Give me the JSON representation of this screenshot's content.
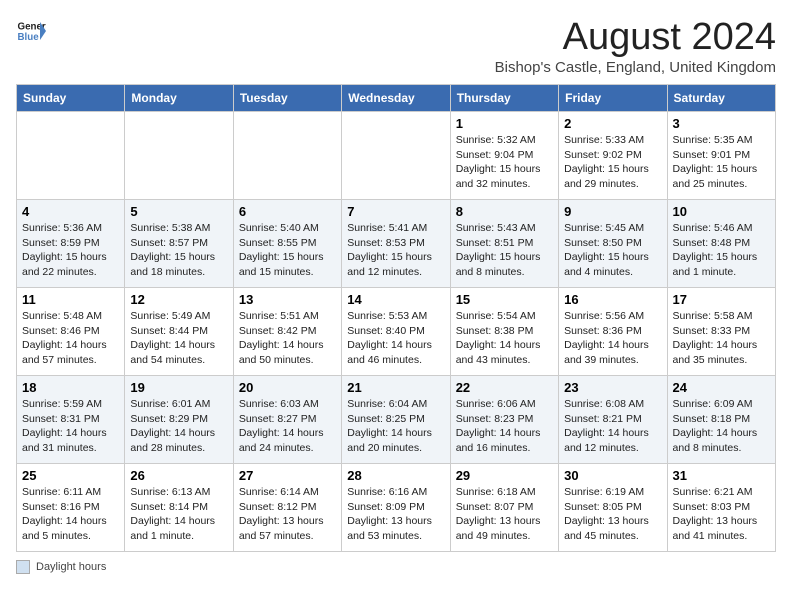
{
  "header": {
    "logo_line1": "General",
    "logo_line2": "Blue",
    "month": "August 2024",
    "location": "Bishop's Castle, England, United Kingdom"
  },
  "days_of_week": [
    "Sunday",
    "Monday",
    "Tuesday",
    "Wednesday",
    "Thursday",
    "Friday",
    "Saturday"
  ],
  "weeks": [
    [
      {
        "day": "",
        "info": ""
      },
      {
        "day": "",
        "info": ""
      },
      {
        "day": "",
        "info": ""
      },
      {
        "day": "",
        "info": ""
      },
      {
        "day": "1",
        "info": "Sunrise: 5:32 AM\nSunset: 9:04 PM\nDaylight: 15 hours\nand 32 minutes."
      },
      {
        "day": "2",
        "info": "Sunrise: 5:33 AM\nSunset: 9:02 PM\nDaylight: 15 hours\nand 29 minutes."
      },
      {
        "day": "3",
        "info": "Sunrise: 5:35 AM\nSunset: 9:01 PM\nDaylight: 15 hours\nand 25 minutes."
      }
    ],
    [
      {
        "day": "4",
        "info": "Sunrise: 5:36 AM\nSunset: 8:59 PM\nDaylight: 15 hours\nand 22 minutes."
      },
      {
        "day": "5",
        "info": "Sunrise: 5:38 AM\nSunset: 8:57 PM\nDaylight: 15 hours\nand 18 minutes."
      },
      {
        "day": "6",
        "info": "Sunrise: 5:40 AM\nSunset: 8:55 PM\nDaylight: 15 hours\nand 15 minutes."
      },
      {
        "day": "7",
        "info": "Sunrise: 5:41 AM\nSunset: 8:53 PM\nDaylight: 15 hours\nand 12 minutes."
      },
      {
        "day": "8",
        "info": "Sunrise: 5:43 AM\nSunset: 8:51 PM\nDaylight: 15 hours\nand 8 minutes."
      },
      {
        "day": "9",
        "info": "Sunrise: 5:45 AM\nSunset: 8:50 PM\nDaylight: 15 hours\nand 4 minutes."
      },
      {
        "day": "10",
        "info": "Sunrise: 5:46 AM\nSunset: 8:48 PM\nDaylight: 15 hours\nand 1 minute."
      }
    ],
    [
      {
        "day": "11",
        "info": "Sunrise: 5:48 AM\nSunset: 8:46 PM\nDaylight: 14 hours\nand 57 minutes."
      },
      {
        "day": "12",
        "info": "Sunrise: 5:49 AM\nSunset: 8:44 PM\nDaylight: 14 hours\nand 54 minutes."
      },
      {
        "day": "13",
        "info": "Sunrise: 5:51 AM\nSunset: 8:42 PM\nDaylight: 14 hours\nand 50 minutes."
      },
      {
        "day": "14",
        "info": "Sunrise: 5:53 AM\nSunset: 8:40 PM\nDaylight: 14 hours\nand 46 minutes."
      },
      {
        "day": "15",
        "info": "Sunrise: 5:54 AM\nSunset: 8:38 PM\nDaylight: 14 hours\nand 43 minutes."
      },
      {
        "day": "16",
        "info": "Sunrise: 5:56 AM\nSunset: 8:36 PM\nDaylight: 14 hours\nand 39 minutes."
      },
      {
        "day": "17",
        "info": "Sunrise: 5:58 AM\nSunset: 8:33 PM\nDaylight: 14 hours\nand 35 minutes."
      }
    ],
    [
      {
        "day": "18",
        "info": "Sunrise: 5:59 AM\nSunset: 8:31 PM\nDaylight: 14 hours\nand 31 minutes."
      },
      {
        "day": "19",
        "info": "Sunrise: 6:01 AM\nSunset: 8:29 PM\nDaylight: 14 hours\nand 28 minutes."
      },
      {
        "day": "20",
        "info": "Sunrise: 6:03 AM\nSunset: 8:27 PM\nDaylight: 14 hours\nand 24 minutes."
      },
      {
        "day": "21",
        "info": "Sunrise: 6:04 AM\nSunset: 8:25 PM\nDaylight: 14 hours\nand 20 minutes."
      },
      {
        "day": "22",
        "info": "Sunrise: 6:06 AM\nSunset: 8:23 PM\nDaylight: 14 hours\nand 16 minutes."
      },
      {
        "day": "23",
        "info": "Sunrise: 6:08 AM\nSunset: 8:21 PM\nDaylight: 14 hours\nand 12 minutes."
      },
      {
        "day": "24",
        "info": "Sunrise: 6:09 AM\nSunset: 8:18 PM\nDaylight: 14 hours\nand 8 minutes."
      }
    ],
    [
      {
        "day": "25",
        "info": "Sunrise: 6:11 AM\nSunset: 8:16 PM\nDaylight: 14 hours\nand 5 minutes."
      },
      {
        "day": "26",
        "info": "Sunrise: 6:13 AM\nSunset: 8:14 PM\nDaylight: 14 hours\nand 1 minute."
      },
      {
        "day": "27",
        "info": "Sunrise: 6:14 AM\nSunset: 8:12 PM\nDaylight: 13 hours\nand 57 minutes."
      },
      {
        "day": "28",
        "info": "Sunrise: 6:16 AM\nSunset: 8:09 PM\nDaylight: 13 hours\nand 53 minutes."
      },
      {
        "day": "29",
        "info": "Sunrise: 6:18 AM\nSunset: 8:07 PM\nDaylight: 13 hours\nand 49 minutes."
      },
      {
        "day": "30",
        "info": "Sunrise: 6:19 AM\nSunset: 8:05 PM\nDaylight: 13 hours\nand 45 minutes."
      },
      {
        "day": "31",
        "info": "Sunrise: 6:21 AM\nSunset: 8:03 PM\nDaylight: 13 hours\nand 41 minutes."
      }
    ]
  ],
  "legend": {
    "box_color": "#d0e0f0",
    "text": "Daylight hours"
  }
}
